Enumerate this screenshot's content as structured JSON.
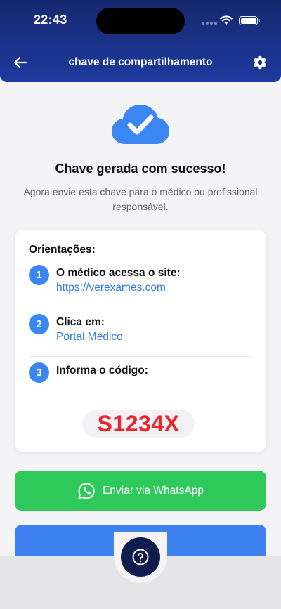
{
  "status_bar": {
    "time": "22:43"
  },
  "header": {
    "title": "chave de compartilhamento"
  },
  "success": {
    "title": "Chave gerada com sucesso!",
    "subtitle": "Agora envie esta chave para o médico ou profissional responsável."
  },
  "instructions": {
    "title": "Orientações:",
    "steps": [
      {
        "number": "1",
        "label": "O médico acessa o site:",
        "link": "https://verexames.com"
      },
      {
        "number": "2",
        "label": "Clica em:",
        "link": "Portal Médico"
      },
      {
        "number": "3",
        "label": "Informa o código:"
      }
    ],
    "code": "S1234X"
  },
  "whatsapp_button": {
    "label": "Enviar via WhatsApp"
  },
  "colors": {
    "header": "#1d3aa0",
    "accent_blue": "#3a86f3",
    "link": "#2f7be8",
    "code_red": "#e8262c",
    "whatsapp_green": "#2fc95b",
    "help_button": "#0f1d4e"
  },
  "icons": {
    "back": "arrow-left-icon",
    "settings": "gear-icon",
    "cloud": "cloud-check-icon",
    "whatsapp": "whatsapp-icon",
    "help": "question-mark-icon"
  }
}
